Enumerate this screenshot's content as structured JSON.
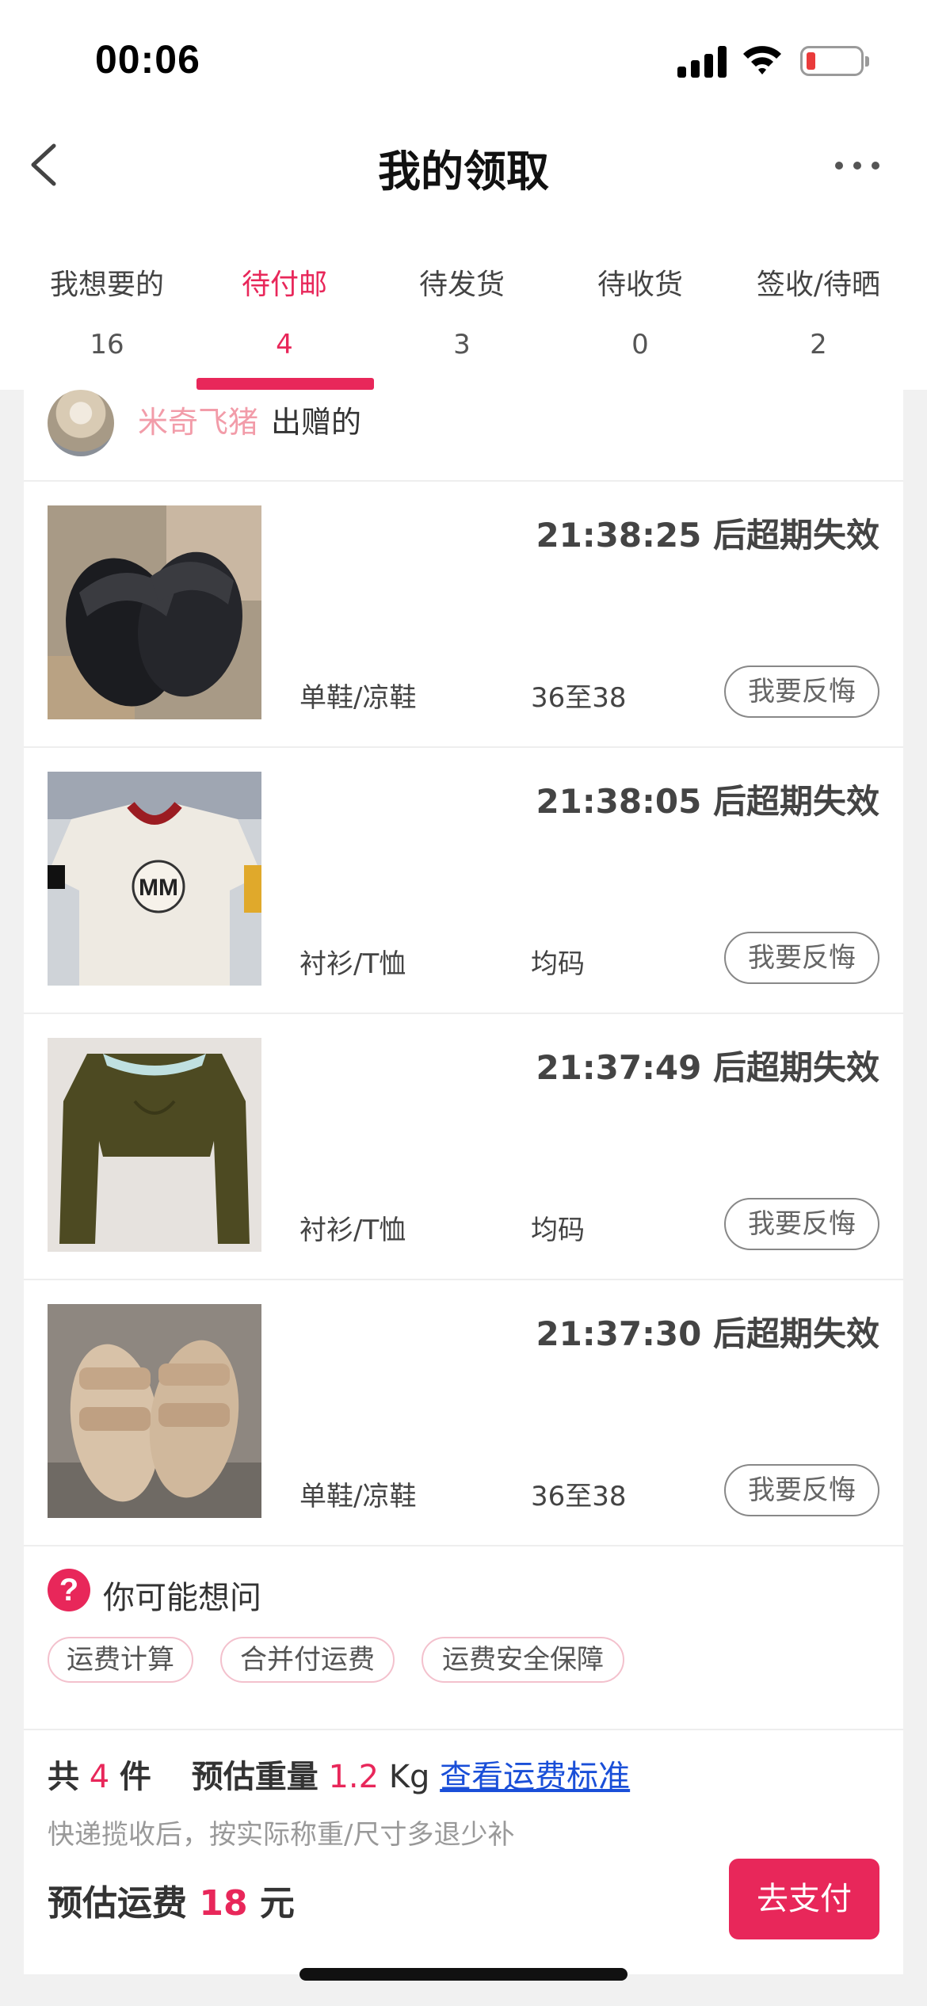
{
  "status_bar": {
    "time": "00:06"
  },
  "nav": {
    "title": "我的领取"
  },
  "tabs": [
    {
      "label": "我想要的",
      "count": "16"
    },
    {
      "label": "待付邮",
      "count": "4"
    },
    {
      "label": "待发货",
      "count": "3"
    },
    {
      "label": "待收货",
      "count": "0"
    },
    {
      "label": "签收/待晒",
      "count": "2"
    }
  ],
  "active_tab": "待付邮",
  "giver": {
    "name": "米奇飞猪",
    "suffix": "出赠的"
  },
  "items": [
    {
      "timer": "21:38:25 后超期失效",
      "category": "单鞋/凉鞋",
      "size": "36至38",
      "action": "我要反悔",
      "thumb_icon": "black-sandals-image"
    },
    {
      "timer": "21:38:05 后超期失效",
      "category": "衬衫/T恤",
      "size": "均码",
      "action": "我要反悔",
      "thumb_icon": "white-tshirt-image"
    },
    {
      "timer": "21:37:49 后超期失效",
      "category": "衬衫/T恤",
      "size": "均码",
      "action": "我要反悔",
      "thumb_icon": "green-top-image"
    },
    {
      "timer": "21:37:30 后超期失效",
      "category": "单鞋/凉鞋",
      "size": "36至38",
      "action": "我要反悔",
      "thumb_icon": "beige-sandals-image"
    }
  ],
  "faq": {
    "title": "你可能想问",
    "chips": [
      "运费计算",
      "合并付运费",
      "运费安全保障"
    ]
  },
  "summary": {
    "count_prefix": "共",
    "count": "4",
    "count_unit": "件",
    "weight_label": "预估重量",
    "weight": "1.2",
    "weight_unit": "Kg",
    "link": "查看运费标准",
    "note": "快递揽收后，按实际称重/尺寸多退少补",
    "fee_label": "预估运费",
    "fee": "18",
    "fee_unit": "元",
    "pay_button": "去支付"
  },
  "colors": {
    "accent": "#e8275a",
    "link": "#1a4fd8",
    "giver_name": "#f29ca9"
  }
}
